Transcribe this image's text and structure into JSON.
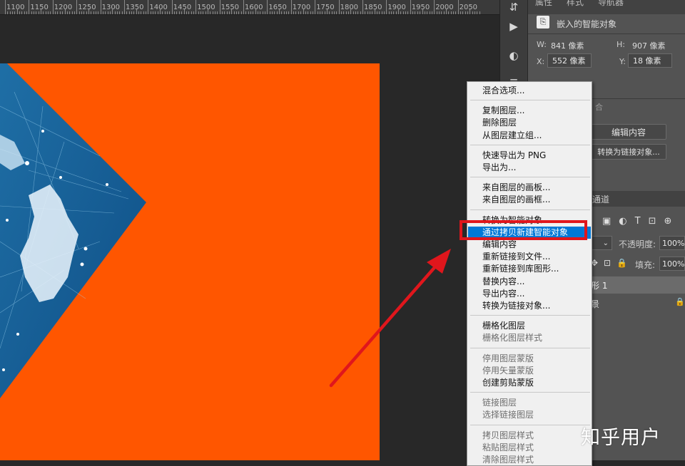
{
  "ruler": {
    "ticks": [
      "1100",
      "1150",
      "1200",
      "1250",
      "1300",
      "1350",
      "1400",
      "1450",
      "1500",
      "1550",
      "1600",
      "1650",
      "1700",
      "1750",
      "1800",
      "1850",
      "1900",
      "1950",
      "2000",
      "2050"
    ]
  },
  "properties": {
    "tabs": [
      "属性",
      "样式",
      "导航器"
    ],
    "smart_object_type": "嵌入的智能对象",
    "w_label": "W:",
    "w_value": "841 像素",
    "h_label": "H:",
    "h_value": "907 像素",
    "x_label": "X:",
    "x_value": "552 像素",
    "y_label": "Y:",
    "y_value": "18 像素",
    "section_label": "合",
    "edit_contents_button": "编辑内容",
    "convert_linked_button": "转换为链接对象..."
  },
  "layers": {
    "tab_label": "通道",
    "opacity_label": "不透明度:",
    "opacity_value": "100%",
    "fill_label": "填充:",
    "fill_value": "100%",
    "layer_name": "形 1",
    "background_name": "景"
  },
  "context_menu": {
    "groups": [
      [
        {
          "label": "混合选项...",
          "enabled": true
        }
      ],
      [
        {
          "label": "复制图层...",
          "enabled": true
        },
        {
          "label": "删除图层",
          "enabled": true
        },
        {
          "label": "从图层建立组...",
          "enabled": true
        }
      ],
      [
        {
          "label": "快速导出为 PNG",
          "enabled": true
        },
        {
          "label": "导出为...",
          "enabled": true
        }
      ],
      [
        {
          "label": "来自图层的画板...",
          "enabled": true
        },
        {
          "label": "来自图层的画框...",
          "enabled": true
        }
      ],
      [
        {
          "label": "转换为智能对象",
          "enabled": true
        },
        {
          "label": "通过拷贝新建智能对象",
          "enabled": true,
          "highlighted": true
        },
        {
          "label": "编辑内容",
          "enabled": true
        },
        {
          "label": "重新链接到文件...",
          "enabled": true
        },
        {
          "label": "重新链接到库图形...",
          "enabled": true
        },
        {
          "label": "替换内容...",
          "enabled": true
        },
        {
          "label": "导出内容...",
          "enabled": true
        },
        {
          "label": "转换为链接对象...",
          "enabled": true
        }
      ],
      [
        {
          "label": "栅格化图层",
          "enabled": true
        },
        {
          "label": "栅格化图层样式",
          "enabled": false
        }
      ],
      [
        {
          "label": "停用图层蒙版",
          "enabled": false
        },
        {
          "label": "停用矢量蒙版",
          "enabled": false
        },
        {
          "label": "创建剪贴蒙版",
          "enabled": true
        }
      ],
      [
        {
          "label": "链接图层",
          "enabled": false
        },
        {
          "label": "选择链接图层",
          "enabled": false
        }
      ],
      [
        {
          "label": "拷贝图层样式",
          "enabled": false
        },
        {
          "label": "粘贴图层样式",
          "enabled": false
        },
        {
          "label": "清除图层样式",
          "enabled": false
        }
      ]
    ]
  },
  "watermark": "知乎用户",
  "colors": {
    "document_bg": "#ff5600",
    "highlight": "#0078d7",
    "annotation": "#e0161c"
  }
}
